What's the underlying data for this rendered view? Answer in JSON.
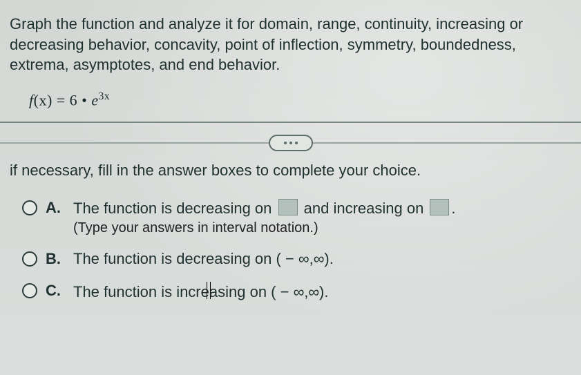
{
  "question": {
    "prompt": "Graph the function and analyze it for domain, range, continuity, increasing or decreasing behavior, concavity, point of inflection, symmetry, boundedness, extrema, asymptotes, and end behavior.",
    "expression_plain": "f(x) = 6 · e^(3x)"
  },
  "instruction": "if necessary, fill in the answer boxes to complete your choice.",
  "choices": {
    "A": {
      "letter": "A.",
      "part1": "The function is decreasing on ",
      "part2": " and increasing on ",
      "part3": ".",
      "hint": "(Type your answers in interval notation.)"
    },
    "B": {
      "letter": "B.",
      "text": "The function is decreasing on ( − ∞,∞)."
    },
    "C": {
      "letter": "C.",
      "text_pre": "The function is incre",
      "text_mid": "a",
      "text_post": "sing on ( − ∞,∞)."
    }
  }
}
